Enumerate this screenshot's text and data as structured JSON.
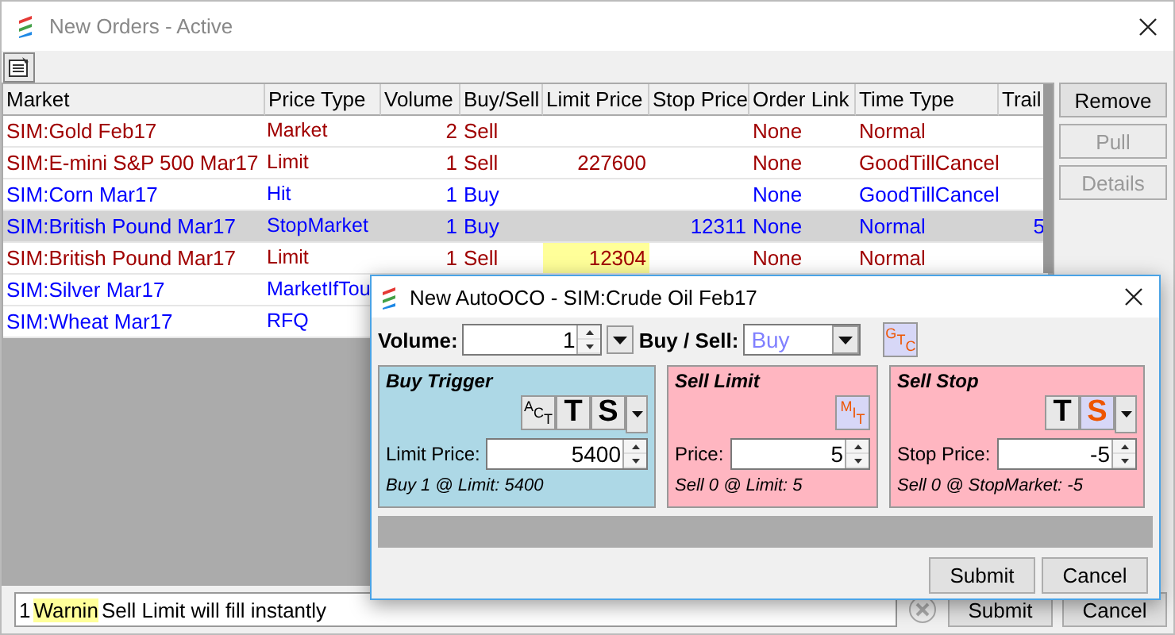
{
  "window": {
    "title": "New Orders - Active"
  },
  "table": {
    "columns": [
      "Market",
      "Price Type",
      "Volume",
      "Buy/Sell",
      "Limit Price",
      "Stop Price",
      "Order Link",
      "Time Type",
      "Trail"
    ],
    "rows": [
      {
        "market": "SIM:Gold Feb17",
        "price_type": "Market",
        "volume": "2",
        "side": "Sell",
        "order_link": "None",
        "time_type": "Normal",
        "color": "#a00000",
        "selected": false
      },
      {
        "market": "SIM:E-mini S&P 500 Mar17",
        "price_type": "Limit",
        "volume": "1",
        "side": "Sell",
        "limit_price": "227600",
        "order_link": "None",
        "time_type": "GoodTillCancel",
        "color": "#a00000",
        "selected": false,
        "limit_price_warning": false
      },
      {
        "market": "SIM:Corn Mar17",
        "price_type": "Hit",
        "volume": "1",
        "side": "Buy",
        "order_link": "None",
        "time_type": "GoodTillCancel",
        "color": "#0000ff",
        "selected": false
      },
      {
        "market": "SIM:British Pound Mar17",
        "price_type": "StopMarket",
        "volume": "1",
        "side": "Buy",
        "stop_price": "12311",
        "order_link": "None",
        "time_type": "Normal",
        "trail": "5",
        "color": "#0000ff",
        "selected": true
      },
      {
        "market": "SIM:British Pound Mar17",
        "price_type": "Limit",
        "volume": "1",
        "side": "Sell",
        "limit_price": "12304",
        "order_link": "None",
        "time_type": "Normal",
        "color": "#a00000",
        "selected": false,
        "limit_price_warning": true
      },
      {
        "market": "SIM:Silver Mar17",
        "price_type": "MarketIfTou",
        "color": "#0000ff",
        "selected": false
      },
      {
        "market": "SIM:Wheat Mar17",
        "price_type": "RFQ",
        "color": "#0000ff",
        "selected": false
      }
    ]
  },
  "side_buttons": [
    {
      "label": "Remove",
      "disabled": false
    },
    {
      "label": "Pull",
      "disabled": true
    },
    {
      "label": "Details",
      "disabled": true
    }
  ],
  "status_bar": {
    "count": "1",
    "severity": "Warnin",
    "message": "Sell Limit will fill instantly"
  },
  "bottom_buttons": [
    "Submit",
    "Cancel"
  ],
  "dialog": {
    "title": "New AutoOCO - SIM:Crude Oil Feb17",
    "volume": {
      "label": "Volume:",
      "value": "1"
    },
    "buy_sell": {
      "label": "Buy / Sell:",
      "value": "Buy"
    },
    "gtc": {
      "label": "GTC",
      "selected": true
    },
    "panels": [
      {
        "kind": "buy",
        "title": "Buy Trigger",
        "toggles": [
          {
            "label": "ACT",
            "kind": "stacked",
            "selected": false
          },
          {
            "label": "T",
            "kind": "bold",
            "selected": false
          },
          {
            "label": "S",
            "kind": "bold",
            "selected": false
          }
        ],
        "menu": true,
        "field_label": "Limit Price:",
        "value": "5400",
        "summary": "Buy 1 @ Limit: 5400"
      },
      {
        "kind": "sell",
        "title": "Sell Limit",
        "toggles": [
          {
            "label": "MIT",
            "kind": "stacked",
            "selected": true
          }
        ],
        "menu": false,
        "field_label": "Price:",
        "value": "5",
        "summary": "Sell 0 @ Limit: 5"
      },
      {
        "kind": "sell",
        "title": "Sell Stop",
        "toggles": [
          {
            "label": "T",
            "kind": "bold",
            "selected": false
          },
          {
            "label": "S",
            "kind": "bold",
            "selected": true
          }
        ],
        "menu": true,
        "field_label": "Stop Price:",
        "value": "-5",
        "summary": "Sell 0 @ StopMarket: -5"
      }
    ],
    "buttons": [
      "Submit",
      "Cancel"
    ]
  }
}
